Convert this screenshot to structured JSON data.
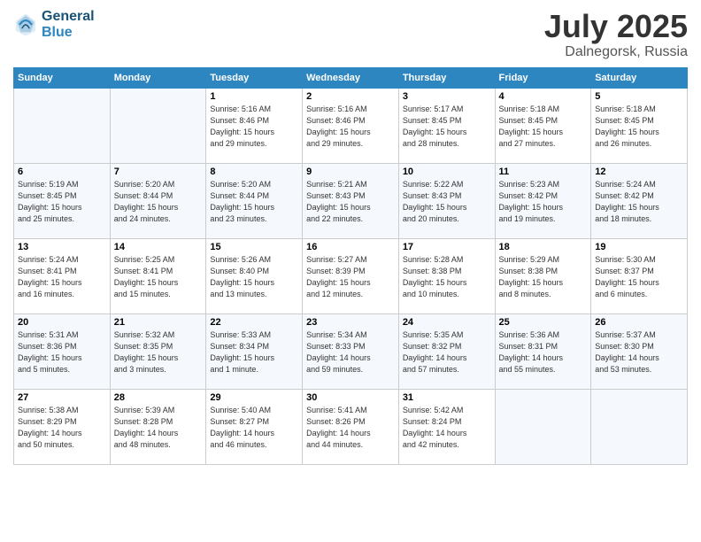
{
  "logo": {
    "line1": "General",
    "line2": "Blue"
  },
  "title": {
    "month_year": "July 2025",
    "location": "Dalnegorsk, Russia"
  },
  "days_of_week": [
    "Sunday",
    "Monday",
    "Tuesday",
    "Wednesday",
    "Thursday",
    "Friday",
    "Saturday"
  ],
  "weeks": [
    [
      {
        "day": "",
        "detail": ""
      },
      {
        "day": "",
        "detail": ""
      },
      {
        "day": "1",
        "detail": "Sunrise: 5:16 AM\nSunset: 8:46 PM\nDaylight: 15 hours\nand 29 minutes."
      },
      {
        "day": "2",
        "detail": "Sunrise: 5:16 AM\nSunset: 8:46 PM\nDaylight: 15 hours\nand 29 minutes."
      },
      {
        "day": "3",
        "detail": "Sunrise: 5:17 AM\nSunset: 8:45 PM\nDaylight: 15 hours\nand 28 minutes."
      },
      {
        "day": "4",
        "detail": "Sunrise: 5:18 AM\nSunset: 8:45 PM\nDaylight: 15 hours\nand 27 minutes."
      },
      {
        "day": "5",
        "detail": "Sunrise: 5:18 AM\nSunset: 8:45 PM\nDaylight: 15 hours\nand 26 minutes."
      }
    ],
    [
      {
        "day": "6",
        "detail": "Sunrise: 5:19 AM\nSunset: 8:45 PM\nDaylight: 15 hours\nand 25 minutes."
      },
      {
        "day": "7",
        "detail": "Sunrise: 5:20 AM\nSunset: 8:44 PM\nDaylight: 15 hours\nand 24 minutes."
      },
      {
        "day": "8",
        "detail": "Sunrise: 5:20 AM\nSunset: 8:44 PM\nDaylight: 15 hours\nand 23 minutes."
      },
      {
        "day": "9",
        "detail": "Sunrise: 5:21 AM\nSunset: 8:43 PM\nDaylight: 15 hours\nand 22 minutes."
      },
      {
        "day": "10",
        "detail": "Sunrise: 5:22 AM\nSunset: 8:43 PM\nDaylight: 15 hours\nand 20 minutes."
      },
      {
        "day": "11",
        "detail": "Sunrise: 5:23 AM\nSunset: 8:42 PM\nDaylight: 15 hours\nand 19 minutes."
      },
      {
        "day": "12",
        "detail": "Sunrise: 5:24 AM\nSunset: 8:42 PM\nDaylight: 15 hours\nand 18 minutes."
      }
    ],
    [
      {
        "day": "13",
        "detail": "Sunrise: 5:24 AM\nSunset: 8:41 PM\nDaylight: 15 hours\nand 16 minutes."
      },
      {
        "day": "14",
        "detail": "Sunrise: 5:25 AM\nSunset: 8:41 PM\nDaylight: 15 hours\nand 15 minutes."
      },
      {
        "day": "15",
        "detail": "Sunrise: 5:26 AM\nSunset: 8:40 PM\nDaylight: 15 hours\nand 13 minutes."
      },
      {
        "day": "16",
        "detail": "Sunrise: 5:27 AM\nSunset: 8:39 PM\nDaylight: 15 hours\nand 12 minutes."
      },
      {
        "day": "17",
        "detail": "Sunrise: 5:28 AM\nSunset: 8:38 PM\nDaylight: 15 hours\nand 10 minutes."
      },
      {
        "day": "18",
        "detail": "Sunrise: 5:29 AM\nSunset: 8:38 PM\nDaylight: 15 hours\nand 8 minutes."
      },
      {
        "day": "19",
        "detail": "Sunrise: 5:30 AM\nSunset: 8:37 PM\nDaylight: 15 hours\nand 6 minutes."
      }
    ],
    [
      {
        "day": "20",
        "detail": "Sunrise: 5:31 AM\nSunset: 8:36 PM\nDaylight: 15 hours\nand 5 minutes."
      },
      {
        "day": "21",
        "detail": "Sunrise: 5:32 AM\nSunset: 8:35 PM\nDaylight: 15 hours\nand 3 minutes."
      },
      {
        "day": "22",
        "detail": "Sunrise: 5:33 AM\nSunset: 8:34 PM\nDaylight: 15 hours\nand 1 minute."
      },
      {
        "day": "23",
        "detail": "Sunrise: 5:34 AM\nSunset: 8:33 PM\nDaylight: 14 hours\nand 59 minutes."
      },
      {
        "day": "24",
        "detail": "Sunrise: 5:35 AM\nSunset: 8:32 PM\nDaylight: 14 hours\nand 57 minutes."
      },
      {
        "day": "25",
        "detail": "Sunrise: 5:36 AM\nSunset: 8:31 PM\nDaylight: 14 hours\nand 55 minutes."
      },
      {
        "day": "26",
        "detail": "Sunrise: 5:37 AM\nSunset: 8:30 PM\nDaylight: 14 hours\nand 53 minutes."
      }
    ],
    [
      {
        "day": "27",
        "detail": "Sunrise: 5:38 AM\nSunset: 8:29 PM\nDaylight: 14 hours\nand 50 minutes."
      },
      {
        "day": "28",
        "detail": "Sunrise: 5:39 AM\nSunset: 8:28 PM\nDaylight: 14 hours\nand 48 minutes."
      },
      {
        "day": "29",
        "detail": "Sunrise: 5:40 AM\nSunset: 8:27 PM\nDaylight: 14 hours\nand 46 minutes."
      },
      {
        "day": "30",
        "detail": "Sunrise: 5:41 AM\nSunset: 8:26 PM\nDaylight: 14 hours\nand 44 minutes."
      },
      {
        "day": "31",
        "detail": "Sunrise: 5:42 AM\nSunset: 8:24 PM\nDaylight: 14 hours\nand 42 minutes."
      },
      {
        "day": "",
        "detail": ""
      },
      {
        "day": "",
        "detail": ""
      }
    ]
  ]
}
